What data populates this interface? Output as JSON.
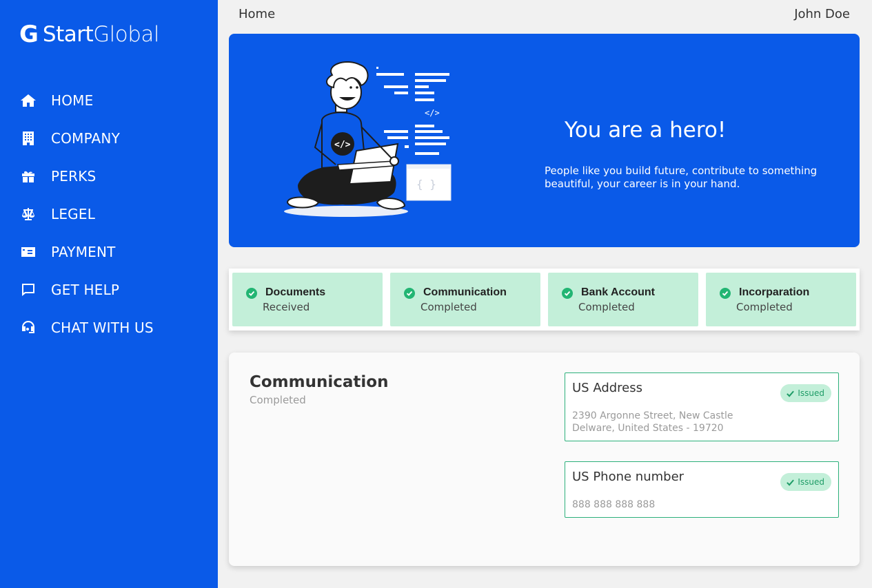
{
  "brand": {
    "mark": "G",
    "name_bold": "Start",
    "name_light": "Global"
  },
  "sidebar": {
    "items": [
      {
        "icon": "home-icon",
        "label": "HOME"
      },
      {
        "icon": "building-icon",
        "label": "COMPANY"
      },
      {
        "icon": "gift-icon",
        "label": "PERKS"
      },
      {
        "icon": "scale-icon",
        "label": "LEGEL"
      },
      {
        "icon": "payment-card-icon",
        "label": "PAYMENT"
      },
      {
        "icon": "chat-bubble-icon",
        "label": "GET HELP"
      },
      {
        "icon": "headset-icon",
        "label": "CHAT WITH US"
      }
    ]
  },
  "header": {
    "breadcrumb": "Home",
    "user_name": "John Doe"
  },
  "hero": {
    "title": "You are a hero!",
    "text": "People like you build future, contribute to something beautiful, your career is in your hand.",
    "code_tag": "</>",
    "bracket_tag": "{ }"
  },
  "status_cards": [
    {
      "title": "Documents",
      "status": "Received"
    },
    {
      "title": "Communication",
      "status": "Completed"
    },
    {
      "title": "Bank Account",
      "status": "Completed"
    },
    {
      "title": "Incorparation",
      "status": "Completed"
    }
  ],
  "detail": {
    "title": "Communication",
    "status": "Completed",
    "items": [
      {
        "title": "US Address",
        "badge": "Issued",
        "value_line1": "2390 Argonne Street, New Castle",
        "value_line2": "Delware, United States - 19720"
      },
      {
        "title": "US Phone number",
        "badge": "Issued",
        "value_line1": "888 888 888 888"
      }
    ]
  },
  "colors": {
    "primary": "#0a5ae8",
    "success_bg": "#c3efd9",
    "success": "#1f9c67",
    "border_green": "#2bb07a"
  }
}
